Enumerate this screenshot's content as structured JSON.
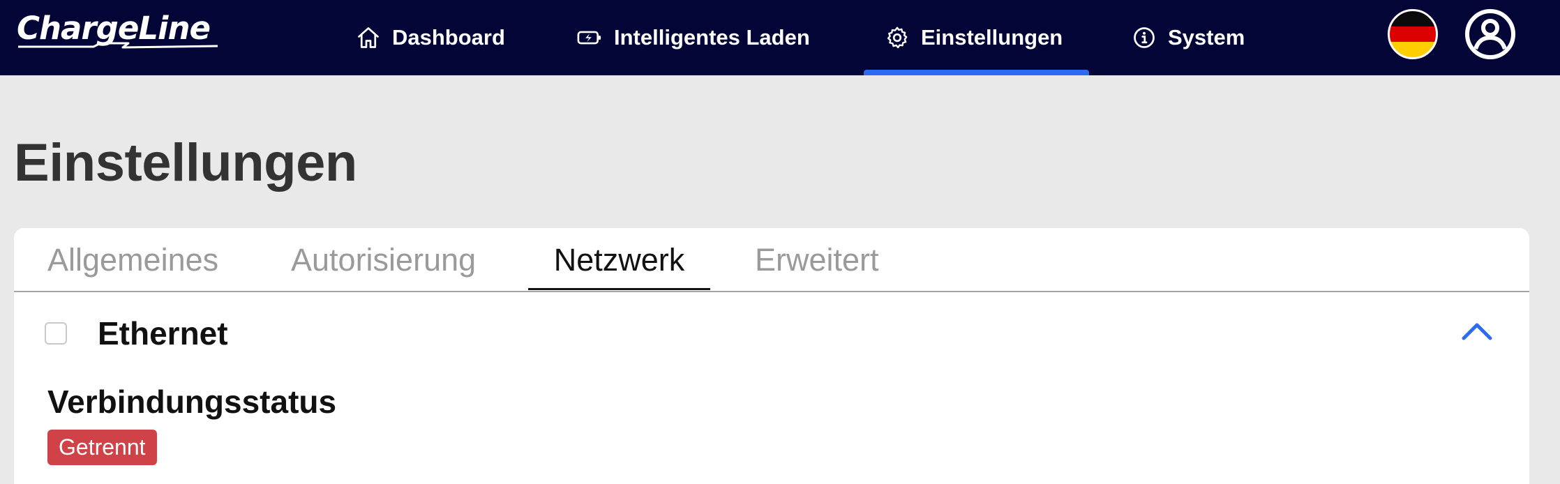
{
  "app": {
    "brand": "ChargeLine"
  },
  "nav": {
    "items": [
      {
        "label": "Dashboard",
        "icon": "home-icon"
      },
      {
        "label": "Intelligentes Laden",
        "icon": "battery-charging-icon"
      },
      {
        "label": "Einstellungen",
        "icon": "gear-icon",
        "active": true
      },
      {
        "label": "System",
        "icon": "info-icon"
      }
    ],
    "language": "de",
    "user_icon": "user-circle-icon"
  },
  "page": {
    "title": "Einstellungen"
  },
  "tabs": [
    {
      "label": "Allgemeines"
    },
    {
      "label": "Autorisierung"
    },
    {
      "label": "Netzwerk",
      "active": true
    },
    {
      "label": "Erweitert"
    }
  ],
  "section": {
    "title": "Ethernet",
    "checked": false,
    "expanded": true,
    "status_label": "Verbindungsstatus",
    "status_value": "Getrennt"
  },
  "colors": {
    "topbar": "#030537",
    "accent": "#2d6cf0",
    "status_disconnected": "#cf4348",
    "background": "#e9e9e9"
  }
}
